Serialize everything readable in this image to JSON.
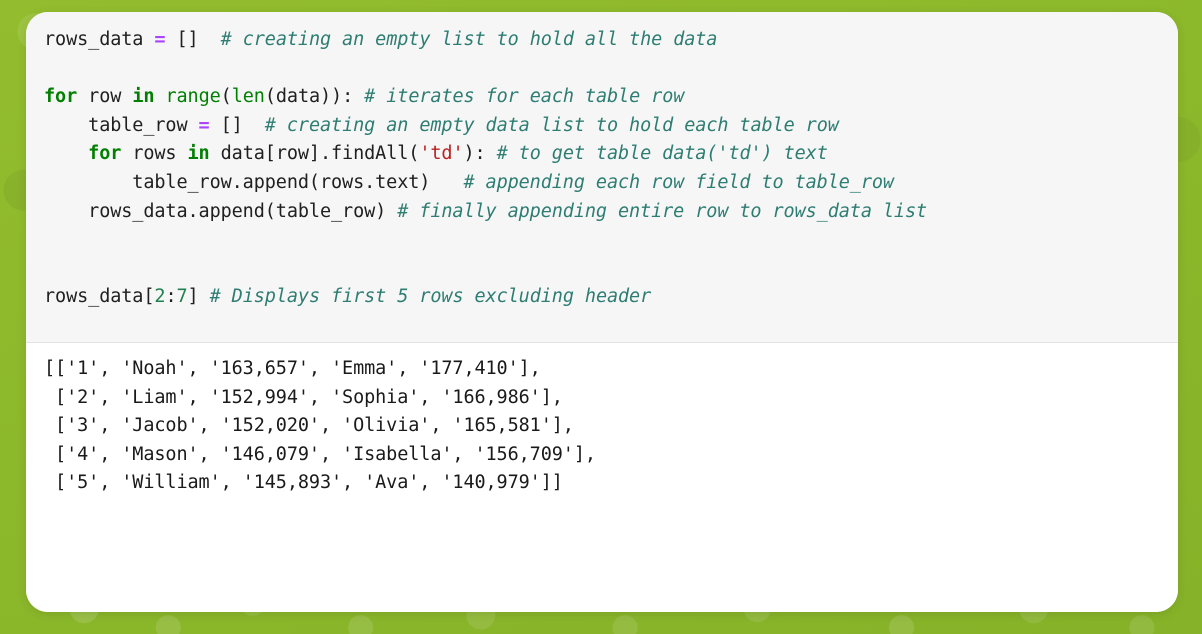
{
  "page": {
    "background_color": "#8cb82b",
    "card_background": "#ffffff",
    "code_cell_background": "#f6f6f6",
    "output_cell_background": "#ffffff"
  },
  "theme": {
    "keyword_color": "#007F00",
    "builtin_color": "#008000",
    "operator_color": "#aa44ff",
    "string_color": "#ba2121",
    "number_color": "#208050",
    "comment_color": "#2e7d72",
    "text_color": "#202020"
  },
  "code_cell": {
    "lines": [
      [
        {
          "t": "rows_data ",
          "c": "txt"
        },
        {
          "t": "=",
          "c": "op"
        },
        {
          "t": " []  ",
          "c": "txt"
        },
        {
          "t": "# creating an empty list to hold all the data",
          "c": "cmt"
        }
      ],
      [],
      [
        {
          "t": "for",
          "c": "kw"
        },
        {
          "t": " row ",
          "c": "txt"
        },
        {
          "t": "in",
          "c": "kw"
        },
        {
          "t": " ",
          "c": "txt"
        },
        {
          "t": "range",
          "c": "bi"
        },
        {
          "t": "(",
          "c": "txt"
        },
        {
          "t": "len",
          "c": "bi"
        },
        {
          "t": "(data)): ",
          "c": "txt"
        },
        {
          "t": "# iterates for each table row",
          "c": "cmt"
        }
      ],
      [
        {
          "t": "    table_row ",
          "c": "txt"
        },
        {
          "t": "=",
          "c": "op"
        },
        {
          "t": " []  ",
          "c": "txt"
        },
        {
          "t": "# creating an empty data list to hold each table row",
          "c": "cmt"
        }
      ],
      [
        {
          "t": "    ",
          "c": "txt"
        },
        {
          "t": "for",
          "c": "kw"
        },
        {
          "t": " rows ",
          "c": "txt"
        },
        {
          "t": "in",
          "c": "kw"
        },
        {
          "t": " data[row].findAll(",
          "c": "txt"
        },
        {
          "t": "'td'",
          "c": "str"
        },
        {
          "t": "): ",
          "c": "txt"
        },
        {
          "t": "# to get table data('td') text",
          "c": "cmt"
        }
      ],
      [
        {
          "t": "        table_row.append(rows.text)   ",
          "c": "txt"
        },
        {
          "t": "# appending each row field to table_row",
          "c": "cmt"
        }
      ],
      [
        {
          "t": "    rows_data.append(table_row) ",
          "c": "txt"
        },
        {
          "t": "# finally appending entire row to rows_data list",
          "c": "cmt"
        }
      ],
      [],
      [],
      [
        {
          "t": "rows_data[",
          "c": "txt"
        },
        {
          "t": "2",
          "c": "num"
        },
        {
          "t": ":",
          "c": "txt"
        },
        {
          "t": "7",
          "c": "num"
        },
        {
          "t": "] ",
          "c": "txt"
        },
        {
          "t": "# Displays first 5 rows excluding header",
          "c": "cmt"
        }
      ]
    ]
  },
  "output_cell": {
    "lines": [
      "[['1', 'Noah', '163,657', 'Emma', '177,410'],",
      " ['2', 'Liam', '152,994', 'Sophia', '166,986'],",
      " ['3', 'Jacob', '152,020', 'Olivia', '165,581'],",
      " ['4', 'Mason', '146,079', 'Isabella', '156,709'],",
      " ['5', 'William', '145,893', 'Ava', '140,979']]"
    ],
    "rows": [
      {
        "rank": "1",
        "boy_name": "Noah",
        "boy_count": "163,657",
        "girl_name": "Emma",
        "girl_count": "177,410"
      },
      {
        "rank": "2",
        "boy_name": "Liam",
        "boy_count": "152,994",
        "girl_name": "Sophia",
        "girl_count": "166,986"
      },
      {
        "rank": "3",
        "boy_name": "Jacob",
        "boy_count": "152,020",
        "girl_name": "Olivia",
        "girl_count": "165,581"
      },
      {
        "rank": "4",
        "boy_name": "Mason",
        "boy_count": "146,079",
        "girl_name": "Isabella",
        "girl_count": "156,709"
      },
      {
        "rank": "5",
        "boy_name": "William",
        "boy_count": "145,893",
        "girl_name": "Ava",
        "girl_count": "140,979"
      }
    ]
  }
}
